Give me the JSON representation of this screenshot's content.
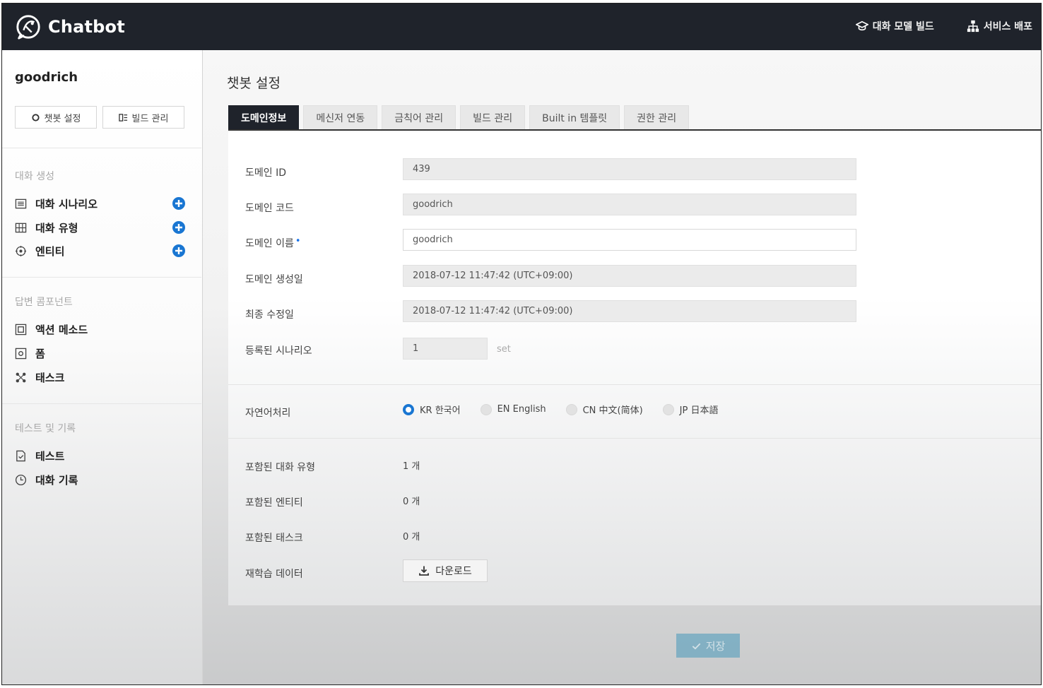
{
  "app": {
    "title": "Chatbot",
    "nav": [
      {
        "label": "대화 모델 빌드",
        "icon": "graduation-cap-icon"
      },
      {
        "label": "서비스 배포",
        "icon": "sitemap-icon"
      }
    ]
  },
  "sidebar": {
    "project_name": "goodrich",
    "buttons": [
      {
        "label": "챗봇 설정",
        "icon": "gear-icon"
      },
      {
        "label": "빌드 관리",
        "icon": "build-icon"
      }
    ],
    "sections": [
      {
        "title": "대화 생성",
        "items": [
          {
            "label": "대화 시나리오",
            "icon": "list-icon",
            "add": true
          },
          {
            "label": "대화 유형",
            "icon": "grid-icon",
            "add": true
          },
          {
            "label": "엔티티",
            "icon": "entity-icon",
            "add": true
          }
        ]
      },
      {
        "title": "답변 콤포넌트",
        "items": [
          {
            "label": "액션 메소드",
            "icon": "action-icon"
          },
          {
            "label": "폼",
            "icon": "form-icon"
          },
          {
            "label": "태스크",
            "icon": "task-icon"
          }
        ]
      },
      {
        "title": "테스트 및 기록",
        "items": [
          {
            "label": "테스트",
            "icon": "test-icon"
          },
          {
            "label": "대화 기록",
            "icon": "clock-icon"
          }
        ]
      }
    ]
  },
  "main": {
    "title": "챗봇 설정",
    "tabs": [
      "도메인정보",
      "메신저 연동",
      "금칙어 관리",
      "빌드 관리",
      "Built in 템플릿",
      "권한 관리"
    ],
    "active_tab": 0,
    "fields": {
      "domain_id": {
        "label": "도메인 ID",
        "value": "439"
      },
      "domain_code": {
        "label": "도메인 코드",
        "value": "goodrich"
      },
      "domain_name": {
        "label": "도메인 이름",
        "value": "goodrich",
        "required_mark": "•"
      },
      "created": {
        "label": "도메인 생성일",
        "value": "2018-07-12 11:47:42 (UTC+09:00)"
      },
      "modified": {
        "label": "최종 수정일",
        "value": "2018-07-12 11:47:42 (UTC+09:00)"
      },
      "scenarios": {
        "label": "등록된 시나리오",
        "value": "1",
        "unit": "set"
      }
    },
    "nlp": {
      "label": "자연어처리",
      "options": [
        {
          "label": "KR 한국어",
          "checked": true
        },
        {
          "label": "EN English",
          "checked": false
        },
        {
          "label": "CN 中文(简体)",
          "checked": false
        },
        {
          "label": "JP 日本語",
          "checked": false
        }
      ]
    },
    "summary": {
      "intents": {
        "label": "포함된 대화 유형",
        "value": "1 개"
      },
      "entities": {
        "label": "포함된 엔티티",
        "value": "0 개"
      },
      "tasks": {
        "label": "포함된 태스크",
        "value": "0 개"
      },
      "retrain": {
        "label": "재학습 데이터",
        "button": "다운로드"
      }
    },
    "save_label": "저장",
    "accent_color": "#1976d2"
  }
}
